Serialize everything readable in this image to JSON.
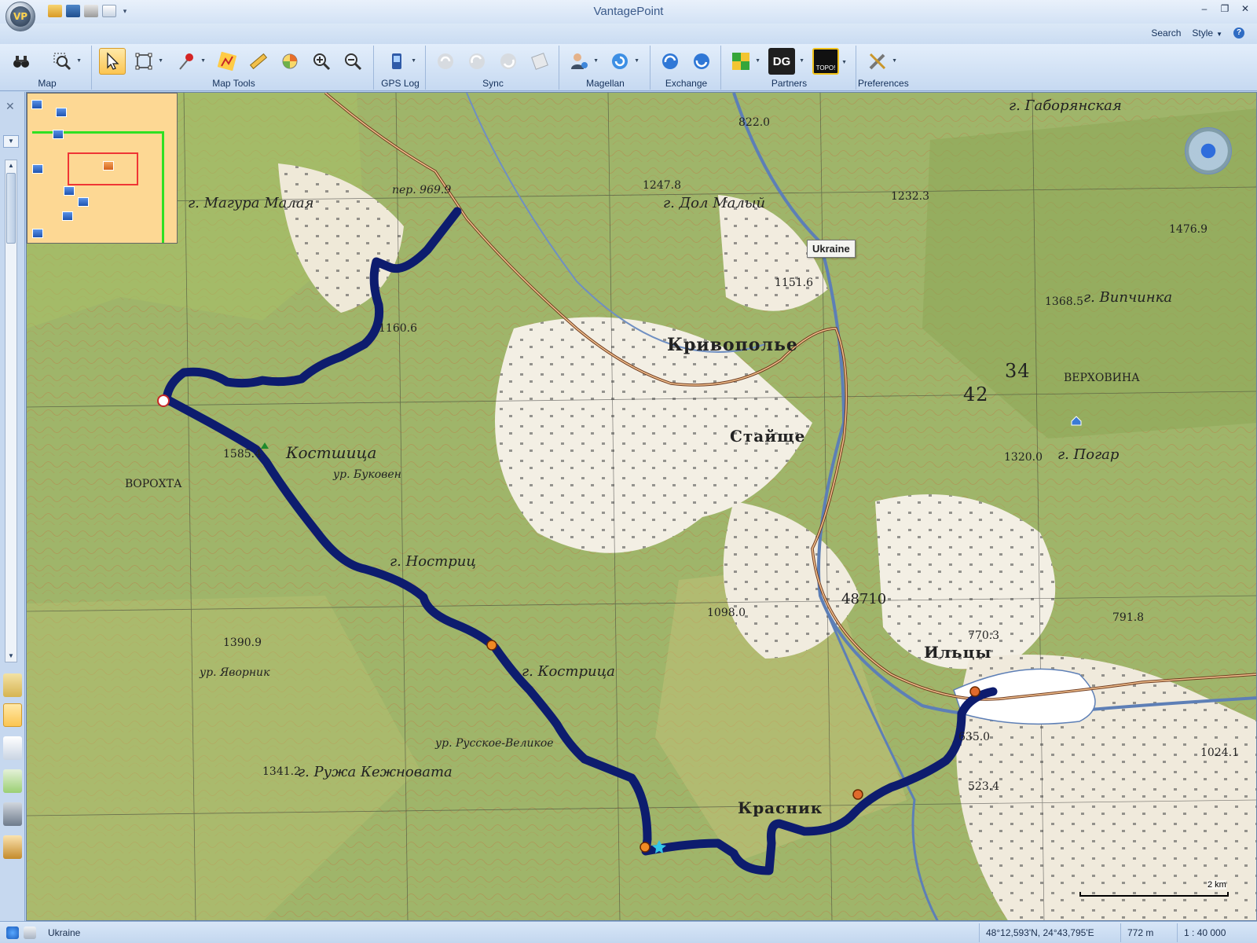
{
  "app": {
    "title": "VantagePoint",
    "orb_label": "VP"
  },
  "ribbon_right": {
    "search_label": "Search",
    "style_label": "Style",
    "help_label": "?"
  },
  "ribbon": {
    "groups": [
      {
        "label": "Map"
      },
      {
        "label": "Map Tools"
      },
      {
        "label": "GPS Log"
      },
      {
        "label": "Sync"
      },
      {
        "label": "Magellan"
      },
      {
        "label": "Exchange"
      },
      {
        "label": "Partners"
      },
      {
        "label": "Preferences"
      }
    ],
    "partners": {
      "dg_label": "DG",
      "topo_label": "TOPO!"
    }
  },
  "map": {
    "tooltip": "Ukraine",
    "labels": {
      "magura": "г. Магура Малая",
      "dol": "г. Дол Малый",
      "gaboryanskaya": "г. Габорянская",
      "krivopolye": "Кривополье",
      "stayshche": "Стайще",
      "kostyshcha": "Костшица",
      "bukoven": "ур. Буковен",
      "vorokhta": "ВОРОХТА",
      "nostrich": "г. Ностриц",
      "kostrytsa": "г. Кострица",
      "yavornik": "ур. Яворник",
      "ruzha": "г. Ружа Кежновата",
      "russkoe": "ур. Русское-Великое",
      "krasnik": "Красник",
      "iltsy": "Ильцы",
      "vypchinka": "г. Випчинка",
      "verkhovina": "ВЕРХОВИНА",
      "pogar": "г. Погар",
      "e1": "1232.3",
      "e2": "1247.8",
      "e3": "1151.6",
      "e4": "1160.6",
      "e5": "1585.4",
      "e6": "1390.9",
      "e7": "1341.2",
      "e8": "1098.0",
      "e9": "1368.5",
      "e10": "1320.0",
      "e11": "1476.9",
      "e12": "822.0",
      "e13": "635.0",
      "e14": "770.3",
      "e15": "791.8",
      "e16": "1024.1",
      "e17": "523.4",
      "pass": "пер. 969.9",
      "grid1": "34",
      "grid2": "42",
      "grid3": "48710"
    },
    "scale_label": "2 km"
  },
  "status": {
    "region": "Ukraine",
    "coords": "48°12,593'N, 24°43,795'E",
    "elevation": "772 m",
    "scale": "1 : 40 000"
  }
}
